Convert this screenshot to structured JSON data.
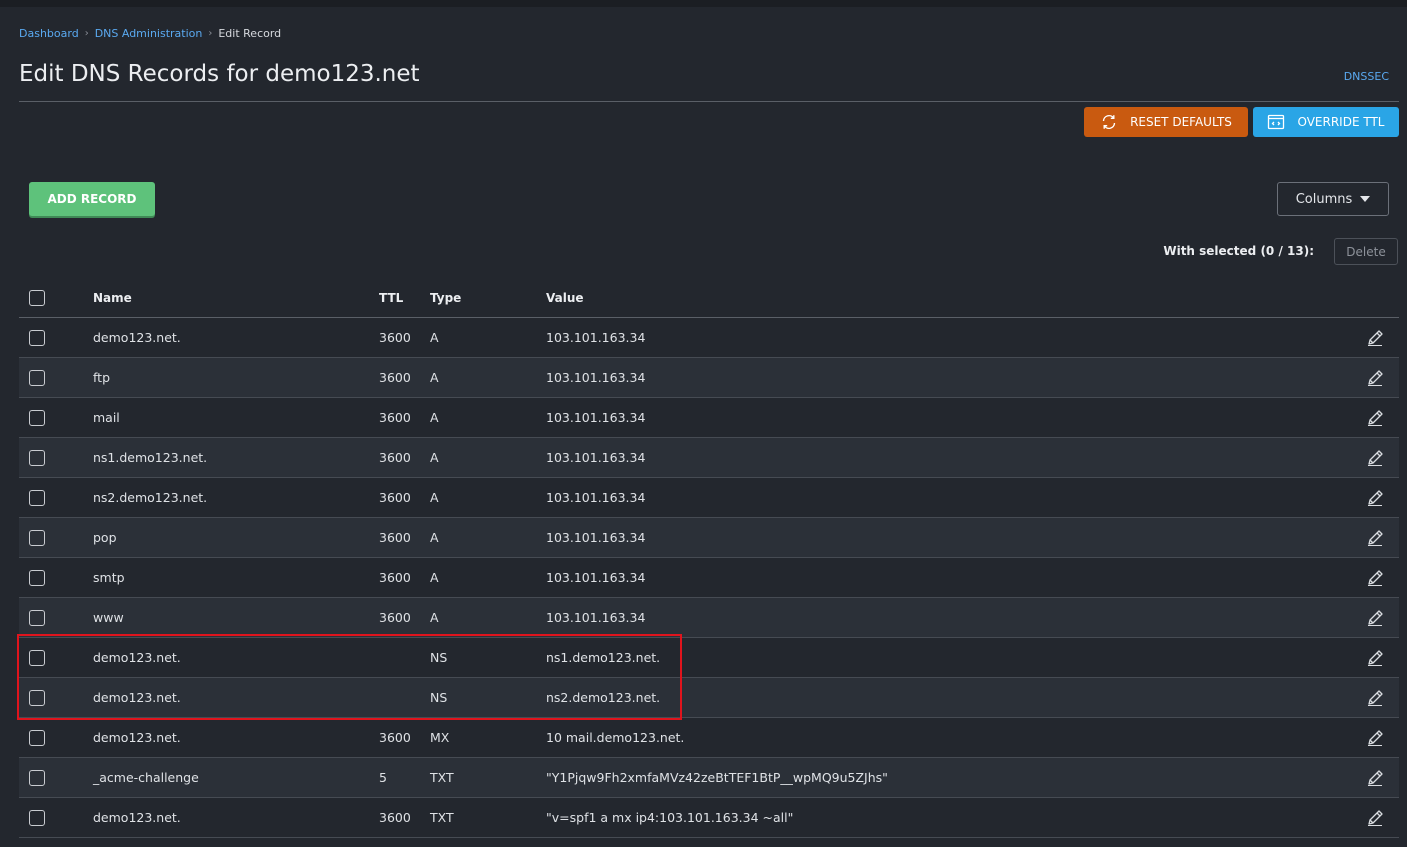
{
  "breadcrumb": {
    "items": [
      "Dashboard",
      "DNS Administration"
    ],
    "current": "Edit Record"
  },
  "page": {
    "title": "Edit DNS Records for demo123.net",
    "dnssec_link": "DNSSEC"
  },
  "toolbar": {
    "reset_label": "RESET DEFAULTS",
    "override_label": "OVERRIDE TTL",
    "add_label": "ADD RECORD",
    "columns_label": "Columns",
    "with_selected": "With selected (0 / 13):",
    "delete_label": "Delete"
  },
  "colors": {
    "reset": "#c95a10",
    "override": "#2aa5e6",
    "add": "#5ec27b",
    "highlight": "#e0141d"
  },
  "table": {
    "headers": {
      "name": "Name",
      "ttl": "TTL",
      "type": "Type",
      "value": "Value"
    },
    "rows": [
      {
        "name": "demo123.net.",
        "ttl": "3600",
        "type": "A",
        "value": "103.101.163.34"
      },
      {
        "name": "ftp",
        "ttl": "3600",
        "type": "A",
        "value": "103.101.163.34"
      },
      {
        "name": "mail",
        "ttl": "3600",
        "type": "A",
        "value": "103.101.163.34"
      },
      {
        "name": "ns1.demo123.net.",
        "ttl": "3600",
        "type": "A",
        "value": "103.101.163.34"
      },
      {
        "name": "ns2.demo123.net.",
        "ttl": "3600",
        "type": "A",
        "value": "103.101.163.34"
      },
      {
        "name": "pop",
        "ttl": "3600",
        "type": "A",
        "value": "103.101.163.34"
      },
      {
        "name": "smtp",
        "ttl": "3600",
        "type": "A",
        "value": "103.101.163.34"
      },
      {
        "name": "www",
        "ttl": "3600",
        "type": "A",
        "value": "103.101.163.34"
      },
      {
        "name": "demo123.net.",
        "ttl": "",
        "type": "NS",
        "value": "ns1.demo123.net."
      },
      {
        "name": "demo123.net.",
        "ttl": "",
        "type": "NS",
        "value": "ns2.demo123.net."
      },
      {
        "name": "demo123.net.",
        "ttl": "3600",
        "type": "MX",
        "value": "10 mail.demo123.net."
      },
      {
        "name": "_acme-challenge",
        "ttl": "5",
        "type": "TXT",
        "value": "\"Y1Pjqw9Fh2xmfaMVz42zeBtTEF1BtP__wpMQ9u5ZJhs\""
      },
      {
        "name": "demo123.net.",
        "ttl": "3600",
        "type": "TXT",
        "value": "\"v=spf1 a mx ip4:103.101.163.34 ~all\""
      }
    ]
  }
}
